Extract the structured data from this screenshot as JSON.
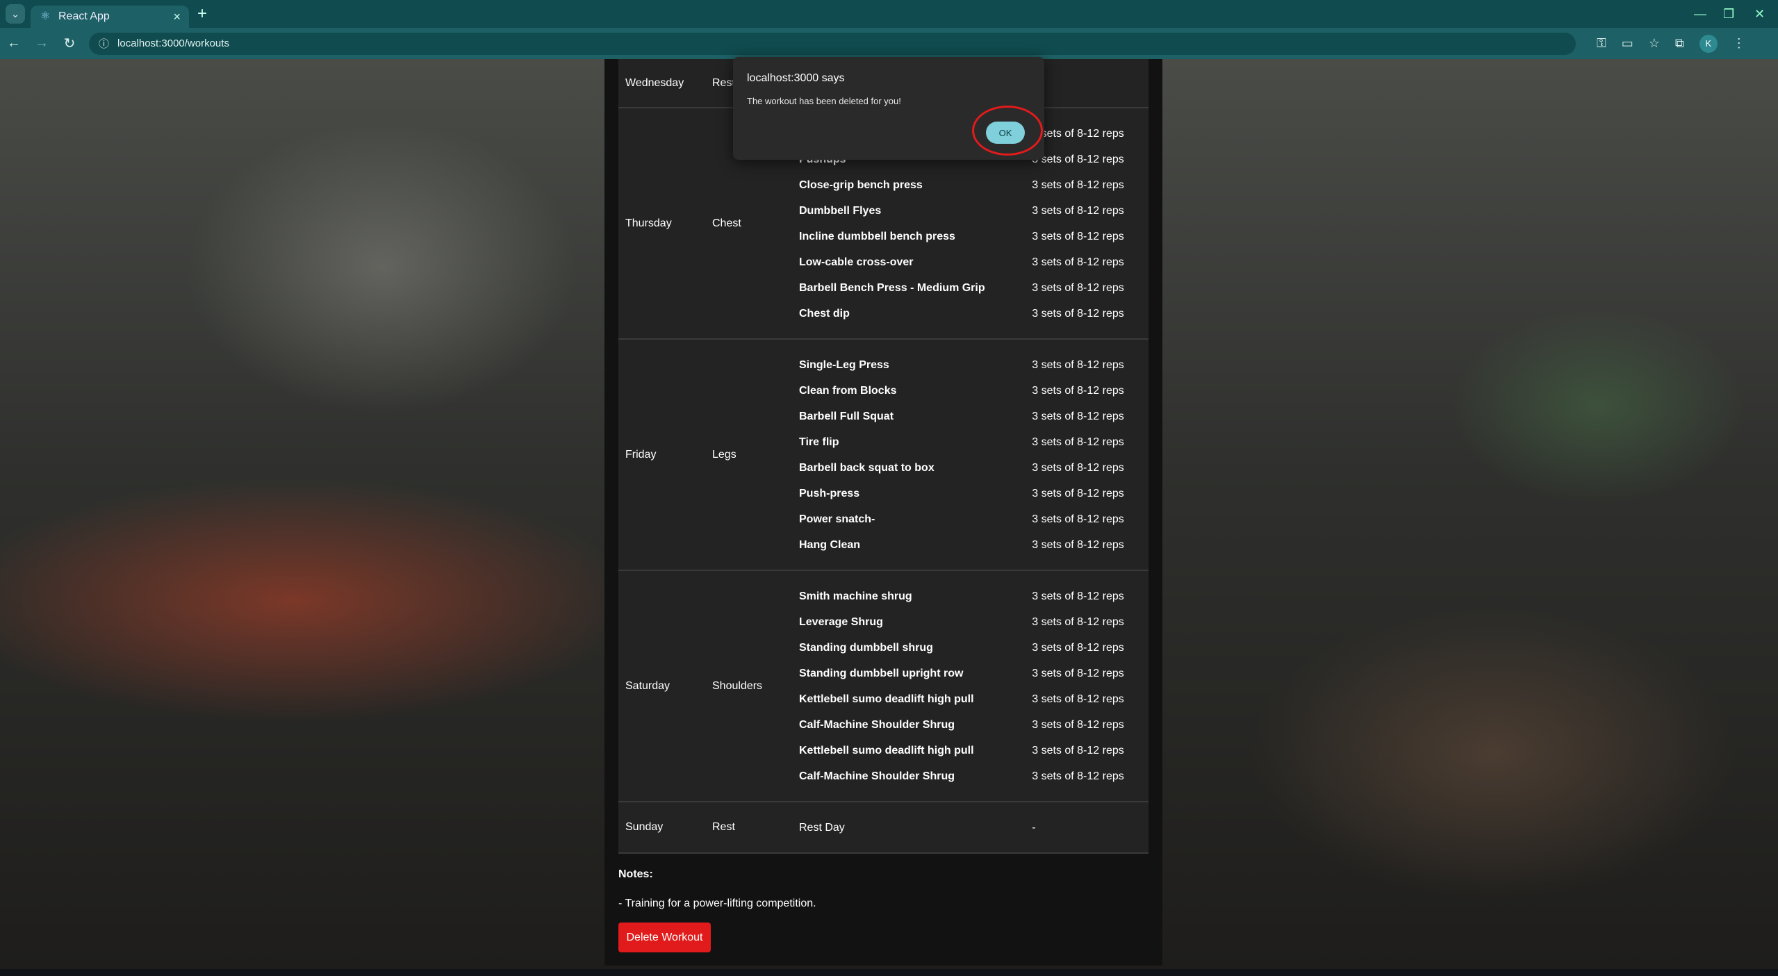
{
  "browser": {
    "tab_title": "React App",
    "url": "localhost:3000/workouts",
    "profile_initial": "K"
  },
  "schedule": [
    {
      "day": "Wednesday",
      "focus": "Rest",
      "exercises": [],
      "sets": []
    },
    {
      "day": "Thursday",
      "focus": "Chest",
      "exercises": [
        "Pushups",
        "Close-grip bench press",
        "Dumbbell Flyes",
        "Incline dumbbell bench press",
        "Low-cable cross-over",
        "Barbell Bench Press - Medium Grip",
        "Chest dip"
      ],
      "sets": [
        "3 sets of 8-12 reps",
        "3 sets of 8-12 reps",
        "3 sets of 8-12 reps",
        "3 sets of 8-12 reps",
        "3 sets of 8-12 reps",
        "3 sets of 8-12 reps",
        "3 sets of 8-12 reps",
        "3 sets of 8-12 reps"
      ]
    },
    {
      "day": "Friday",
      "focus": "Legs",
      "exercises": [
        "Single-Leg Press",
        "Clean from Blocks",
        "Barbell Full Squat",
        "Tire flip",
        "Barbell back squat to box",
        "Push-press",
        "Power snatch-",
        "Hang Clean"
      ],
      "sets": [
        "3 sets of 8-12 reps",
        "3 sets of 8-12 reps",
        "3 sets of 8-12 reps",
        "3 sets of 8-12 reps",
        "3 sets of 8-12 reps",
        "3 sets of 8-12 reps",
        "3 sets of 8-12 reps",
        "3 sets of 8-12 reps"
      ]
    },
    {
      "day": "Saturday",
      "focus": "Shoulders",
      "exercises": [
        "Smith machine shrug",
        "Leverage Shrug",
        "Standing dumbbell shrug",
        "Standing dumbbell upright row",
        "Kettlebell sumo deadlift high pull",
        "Calf-Machine Shoulder Shrug",
        "Kettlebell sumo deadlift high pull",
        "Calf-Machine Shoulder Shrug"
      ],
      "sets": [
        "3 sets of 8-12 reps",
        "3 sets of 8-12 reps",
        "3 sets of 8-12 reps",
        "3 sets of 8-12 reps",
        "3 sets of 8-12 reps",
        "3 sets of 8-12 reps",
        "3 sets of 8-12 reps",
        "3 sets of 8-12 reps"
      ]
    },
    {
      "day": "Sunday",
      "focus": "Rest",
      "exercises": [
        "Rest Day"
      ],
      "sets": [
        "-"
      ]
    }
  ],
  "notes": {
    "label": "Notes:",
    "text": "- Training for a power-lifting competition."
  },
  "delete_label": "Delete Workout",
  "dialog": {
    "title": "localhost:3000 says",
    "message": "The workout has been deleted for you!",
    "ok_label": "OK"
  }
}
